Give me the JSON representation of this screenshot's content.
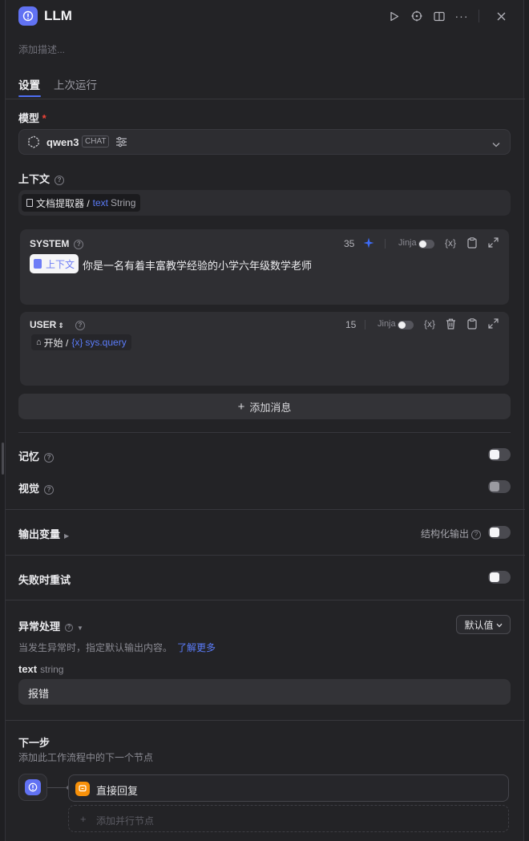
{
  "header": {
    "title": "LLM",
    "description_placeholder": "添加描述...",
    "icons": [
      "play-icon",
      "crosshair-icon",
      "book-icon",
      "more-icon",
      "close-icon"
    ]
  },
  "tabs": [
    {
      "label": "设置",
      "active": true
    },
    {
      "label": "上次运行",
      "active": false
    }
  ],
  "model": {
    "label": "模型",
    "required_mark": "*",
    "name": "qwen3",
    "mode_badge": "CHAT"
  },
  "context": {
    "label": "上下文",
    "node_name": "文档提取器 /",
    "var_name": "text",
    "var_type": "String"
  },
  "system_message": {
    "role": "SYSTEM",
    "count": "35",
    "jinja_label": "Jinja",
    "var_icon": "{x}",
    "context_chip": "上下文",
    "text": "你是一名有着丰富教学经验的小学六年级数学老师"
  },
  "user_message": {
    "role": "USER",
    "count": "15",
    "jinja_label": "Jinja",
    "var_icon": "{x}",
    "node_name": "开始 /",
    "var_name": "sys.query"
  },
  "add_message_label": "添加消息",
  "memory": {
    "label": "记忆",
    "enabled": false
  },
  "vision": {
    "label": "视觉",
    "enabled": false
  },
  "output_vars": {
    "label": "输出变量",
    "structured_label": "结构化输出"
  },
  "retry": {
    "label": "失败时重试"
  },
  "error_handling": {
    "label": "异常处理",
    "select_value": "默认值",
    "hint": "当发生异常时，指定默认输出内容。",
    "learn_more": "了解更多",
    "field_name": "text",
    "field_type": "string",
    "field_value": "报错"
  },
  "next_step": {
    "label": "下一步",
    "hint": "添加此工作流程中的下一个节点",
    "next_node": "直接回复",
    "add_parallel": "添加并行节点"
  },
  "colors": {
    "accent": "#4e6ef2",
    "node_icon": "#6172f3",
    "reply_icon": "#f79009",
    "required": "#f04438",
    "context_chip_text": "#6d7cf6"
  }
}
